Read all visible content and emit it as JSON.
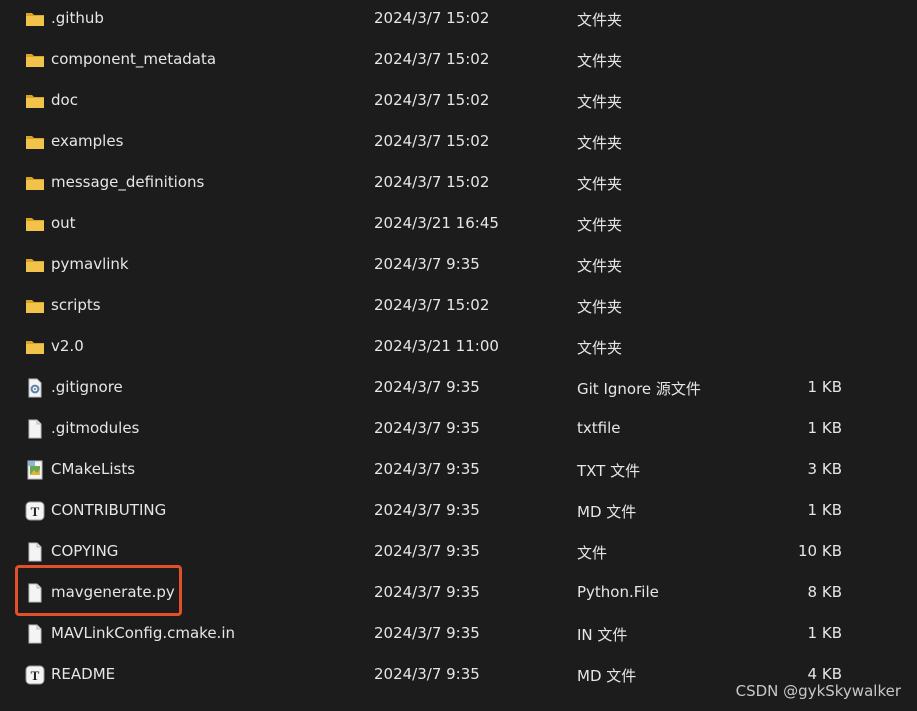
{
  "colors": {
    "background": "#1c1c1c",
    "text": "#e6e6e6",
    "folder": "#e8b83a",
    "highlight": "#e2502a"
  },
  "files": [
    {
      "name": ".github",
      "date": "2024/3/7 15:02",
      "type": "文件夹",
      "size": "",
      "icon": "folder-icon"
    },
    {
      "name": "component_metadata",
      "date": "2024/3/7 15:02",
      "type": "文件夹",
      "size": "",
      "icon": "folder-icon"
    },
    {
      "name": "doc",
      "date": "2024/3/7 15:02",
      "type": "文件夹",
      "size": "",
      "icon": "folder-icon"
    },
    {
      "name": "examples",
      "date": "2024/3/7 15:02",
      "type": "文件夹",
      "size": "",
      "icon": "folder-icon"
    },
    {
      "name": "message_definitions",
      "date": "2024/3/7 15:02",
      "type": "文件夹",
      "size": "",
      "icon": "folder-icon"
    },
    {
      "name": "out",
      "date": "2024/3/21 16:45",
      "type": "文件夹",
      "size": "",
      "icon": "folder-icon"
    },
    {
      "name": "pymavlink",
      "date": "2024/3/7 9:35",
      "type": "文件夹",
      "size": "",
      "icon": "folder-icon"
    },
    {
      "name": "scripts",
      "date": "2024/3/7 15:02",
      "type": "文件夹",
      "size": "",
      "icon": "folder-icon"
    },
    {
      "name": "v2.0",
      "date": "2024/3/21 11:00",
      "type": "文件夹",
      "size": "",
      "icon": "folder-icon"
    },
    {
      "name": ".gitignore",
      "date": "2024/3/7 9:35",
      "type": "Git Ignore 源文件",
      "size": "1 KB",
      "icon": "settings-file-icon"
    },
    {
      "name": ".gitmodules",
      "date": "2024/3/7 9:35",
      "type": "txtfile",
      "size": "1 KB",
      "icon": "file-icon"
    },
    {
      "name": "CMakeLists",
      "date": "2024/3/7 9:35",
      "type": "TXT 文件",
      "size": "3 KB",
      "icon": "text-file-icon"
    },
    {
      "name": "CONTRIBUTING",
      "date": "2024/3/7 9:35",
      "type": "MD 文件",
      "size": "1 KB",
      "icon": "markdown-file-icon"
    },
    {
      "name": "COPYING",
      "date": "2024/3/7 9:35",
      "type": "文件",
      "size": "10 KB",
      "icon": "file-icon"
    },
    {
      "name": "mavgenerate.py",
      "date": "2024/3/7 9:35",
      "type": "Python.File",
      "size": "8 KB",
      "icon": "file-icon"
    },
    {
      "name": "MAVLinkConfig.cmake.in",
      "date": "2024/3/7 9:35",
      "type": "IN 文件",
      "size": "1 KB",
      "icon": "file-icon"
    },
    {
      "name": "README",
      "date": "2024/3/7 9:35",
      "type": "MD 文件",
      "size": "4 KB",
      "icon": "markdown-file-icon"
    }
  ],
  "highlighted_file": "mavgenerate.py",
  "watermark": "CSDN @gykSkywalker"
}
